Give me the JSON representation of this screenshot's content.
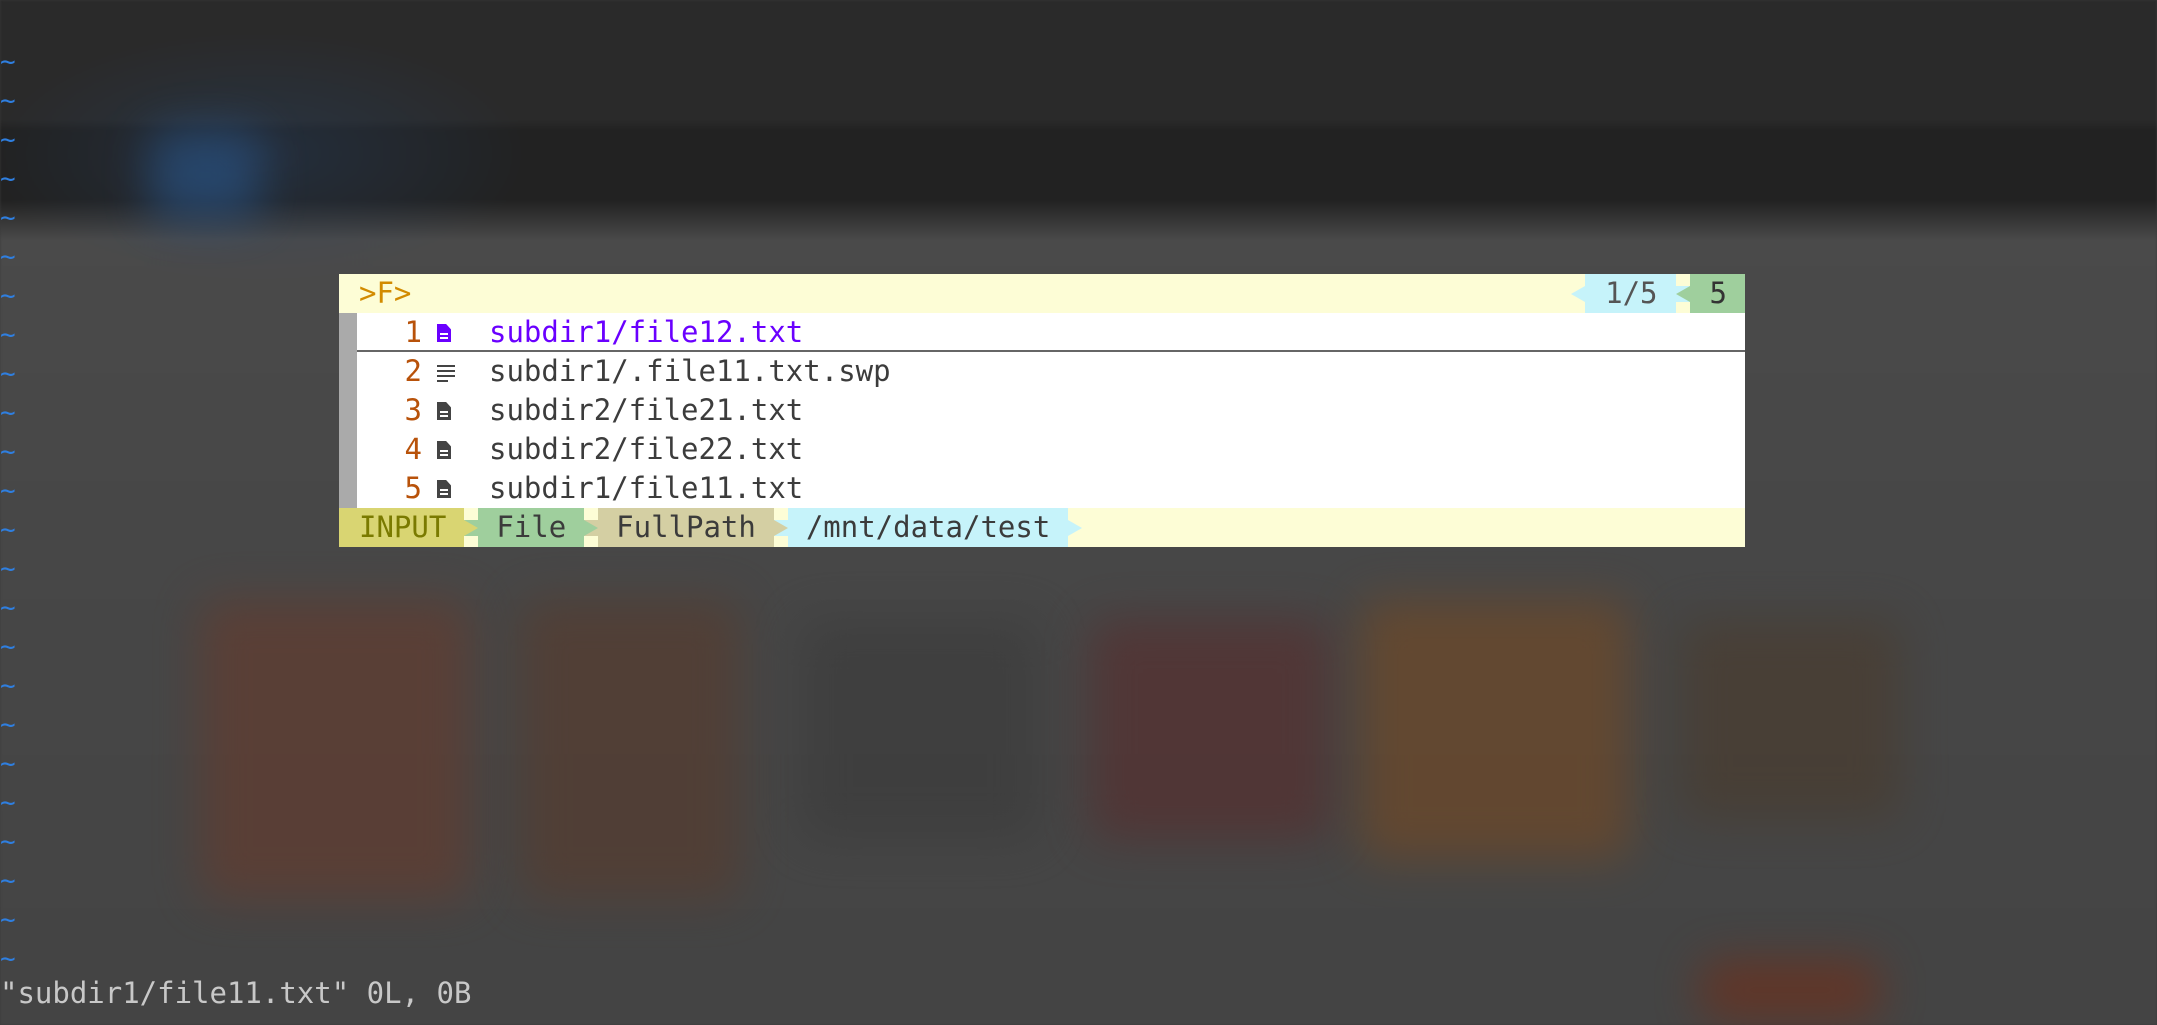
{
  "editor": {
    "tilde_glyph": "~",
    "tilde_count": 24,
    "tilde_color": "#2f7fe0"
  },
  "picker": {
    "prompt": ">F>",
    "counter": "1/5",
    "total": "5",
    "items": [
      {
        "num": "1",
        "icon": "document-icon",
        "name": "subdir1/file12.txt",
        "selected": true
      },
      {
        "num": "2",
        "icon": "text-lines-icon",
        "name": "subdir1/.file11.txt.swp",
        "selected": false
      },
      {
        "num": "3",
        "icon": "document-icon",
        "name": "subdir2/file21.txt",
        "selected": false
      },
      {
        "num": "4",
        "icon": "document-icon",
        "name": "subdir2/file22.txt",
        "selected": false
      },
      {
        "num": "5",
        "icon": "document-icon",
        "name": "subdir1/file11.txt",
        "selected": false
      }
    ],
    "statusline": {
      "mode": "INPUT",
      "category": "File",
      "matcher": "FullPath",
      "cwd": "/mnt/data/test"
    },
    "colors": {
      "prompt_bg": "#fdfdd6",
      "counter_bg": "#c6f3fa",
      "total_bg": "#9fcf9d",
      "selected_text": "#6a00ff",
      "number_text": "#b8520a"
    }
  },
  "cmdline": {
    "text": "\"subdir1/file11.txt\" 0L, 0B"
  }
}
